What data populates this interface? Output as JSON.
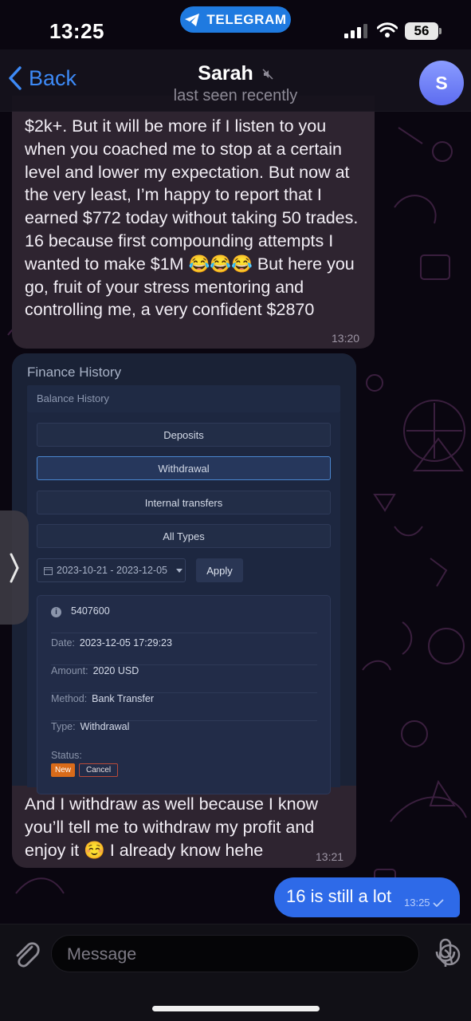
{
  "status_bar": {
    "time": "13:25",
    "app_pill": "TELEGRAM",
    "battery": "56"
  },
  "header": {
    "back_label": "Back",
    "contact_name": "Sarah",
    "last_seen": "last seen recently",
    "avatar_initial": "S"
  },
  "messages": [
    {
      "type": "incoming",
      "text": "$2k+. But it will be more if I listen to you when you coached me to stop at a certain level and lower my expectation. But now at the very least, I’m happy to report that I earned $772 today without taking 50 trades. 16 because first compounding attempts I wanted to make $1M 😂😂😂 But here you go, fruit of your stress mentoring and controlling me, a very confident $2870",
      "time": "13:20"
    },
    {
      "type": "incoming_photo",
      "caption": "And I withdraw as well because I know you’ll tell me to withdraw my profit and enjoy it ☺️ I already know hehe",
      "time": "13:21"
    },
    {
      "type": "outgoing",
      "text": "16 is still a lot",
      "time": "13:25"
    }
  ],
  "finance_screenshot": {
    "title": "Finance History",
    "subtitle": "Balance History",
    "filters": [
      "Deposits",
      "Withdrawal",
      "Internal transfers",
      "All Types"
    ],
    "active_filter": "Withdrawal",
    "date_range": "2023-10-21 - 2023-12-05",
    "apply_label": "Apply",
    "record": {
      "id": "5407600",
      "date_label": "Date:",
      "date": "2023-12-05 17:29:23",
      "amount_label": "Amount:",
      "amount": "2020 USD",
      "method_label": "Method:",
      "method": "Bank Transfer",
      "type_label": "Type:",
      "type": "Withdrawal",
      "status_label": "Status:",
      "status_new": "New",
      "status_cancel": "Cancel"
    }
  },
  "composer": {
    "placeholder": "Message"
  },
  "colors": {
    "accent": "#3d8af7",
    "outgoing_bubble": "#2e6ae8",
    "incoming_bubble": "#2e2430",
    "status_new": "#d96b1a"
  },
  "icons": [
    "telegram-icon",
    "signal-icon",
    "wifi-icon",
    "battery-icon",
    "back-chevron-icon",
    "mute-icon",
    "paperclip-icon",
    "sticker-icon",
    "microphone-icon",
    "read-check-icon",
    "chevron-right-icon",
    "calendar-icon",
    "info-icon"
  ]
}
